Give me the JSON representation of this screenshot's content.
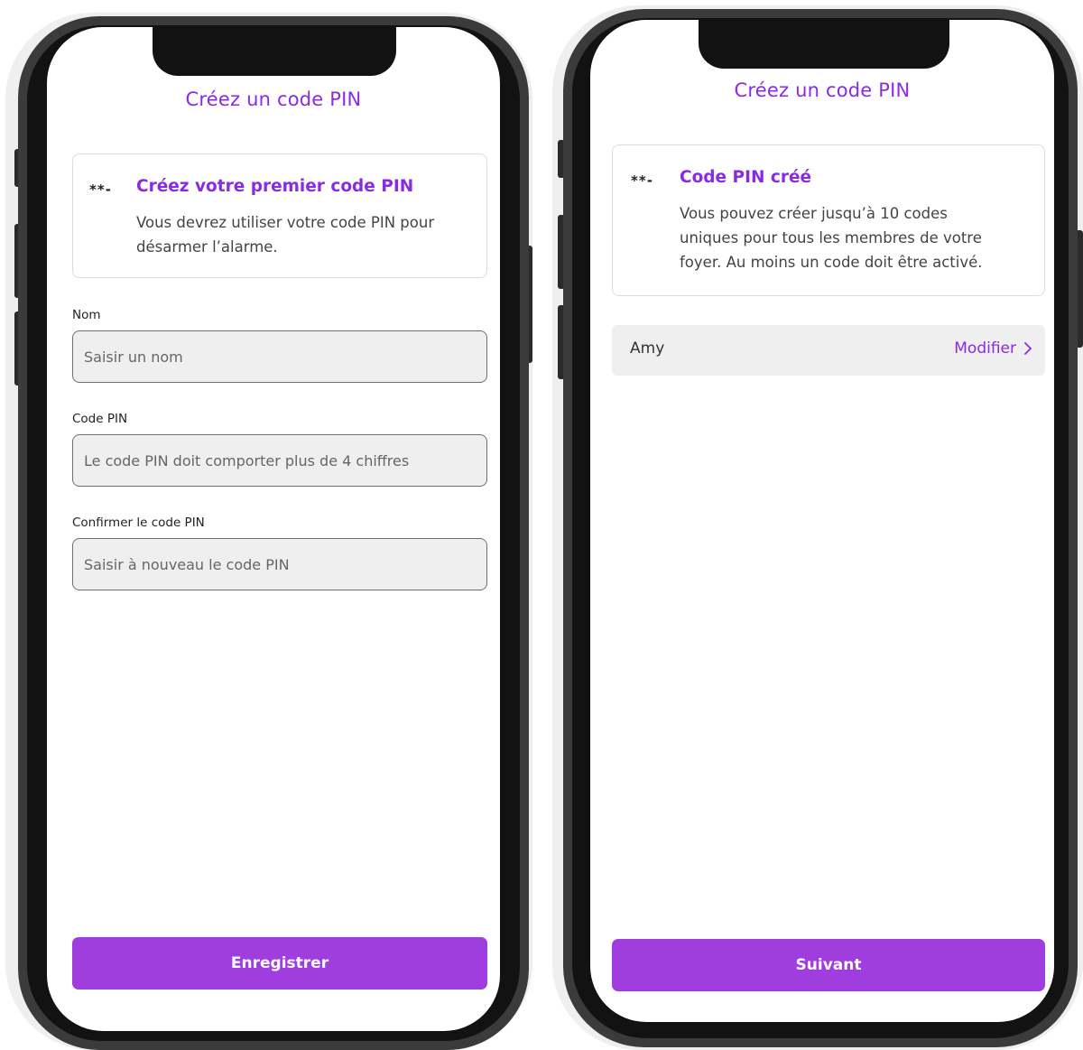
{
  "left_screen": {
    "title": "Créez un code PIN",
    "info_card": {
      "mask": "**-",
      "heading": "Créez votre premier code PIN",
      "body_line1": "Vous devrez utiliser votre code PIN pour",
      "body_line2": "désarmer l’alarme."
    },
    "fields": [
      {
        "label": "Nom",
        "placeholder": "Saisir un nom"
      },
      {
        "label": "Code PIN",
        "placeholder": "Le code PIN doit comporter plus de 4 chiffres"
      },
      {
        "label": "Confirmer le code PIN",
        "placeholder": "Saisir à nouveau le code PIN"
      }
    ],
    "button_label": "Enregistrer"
  },
  "right_screen": {
    "title": "Créez un code PIN",
    "info_card": {
      "mask": "**-",
      "heading": "Code PIN créé",
      "body_line1": "Vous pouvez créer jusqu’à 10 codes",
      "body_line2": "uniques pour tous les membres de votre",
      "body_line3": "foyer. Au moins un code doit être activé."
    },
    "users": [
      {
        "name": "Amy",
        "action_label": "Modifier",
        "action_icon": "chevron-right-icon"
      }
    ],
    "button_label": "Suivant"
  },
  "colors": {
    "accent": "#8a2be2",
    "button": "#a03ddf",
    "field_bg": "#efefef",
    "phone_frame": "#121212"
  }
}
